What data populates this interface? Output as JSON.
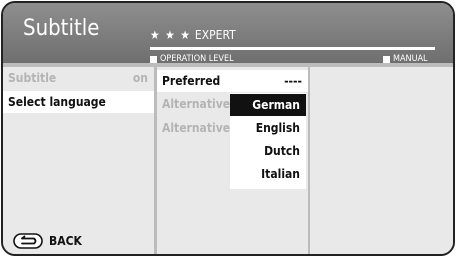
{
  "header": {
    "title": "Subtitle",
    "level_stars": "★ ★ ★",
    "level_name": "EXPERT",
    "operation_level_label": "OPERATION LEVEL",
    "manual_label": "MANUAL"
  },
  "menu": {
    "items": [
      {
        "label": "Subtitle",
        "value": "on"
      },
      {
        "label": "Select language",
        "value": ""
      }
    ]
  },
  "submenu": {
    "items": [
      {
        "label": "Preferred",
        "value": "----"
      },
      {
        "label": "Alternative 1"
      },
      {
        "label": "Alternative 2"
      }
    ]
  },
  "dropdown": {
    "options": [
      "German",
      "English",
      "Dutch",
      "Italian"
    ],
    "selected": "German"
  },
  "footer": {
    "back_label": "BACK",
    "back_icon": "back-arrow-icon"
  }
}
